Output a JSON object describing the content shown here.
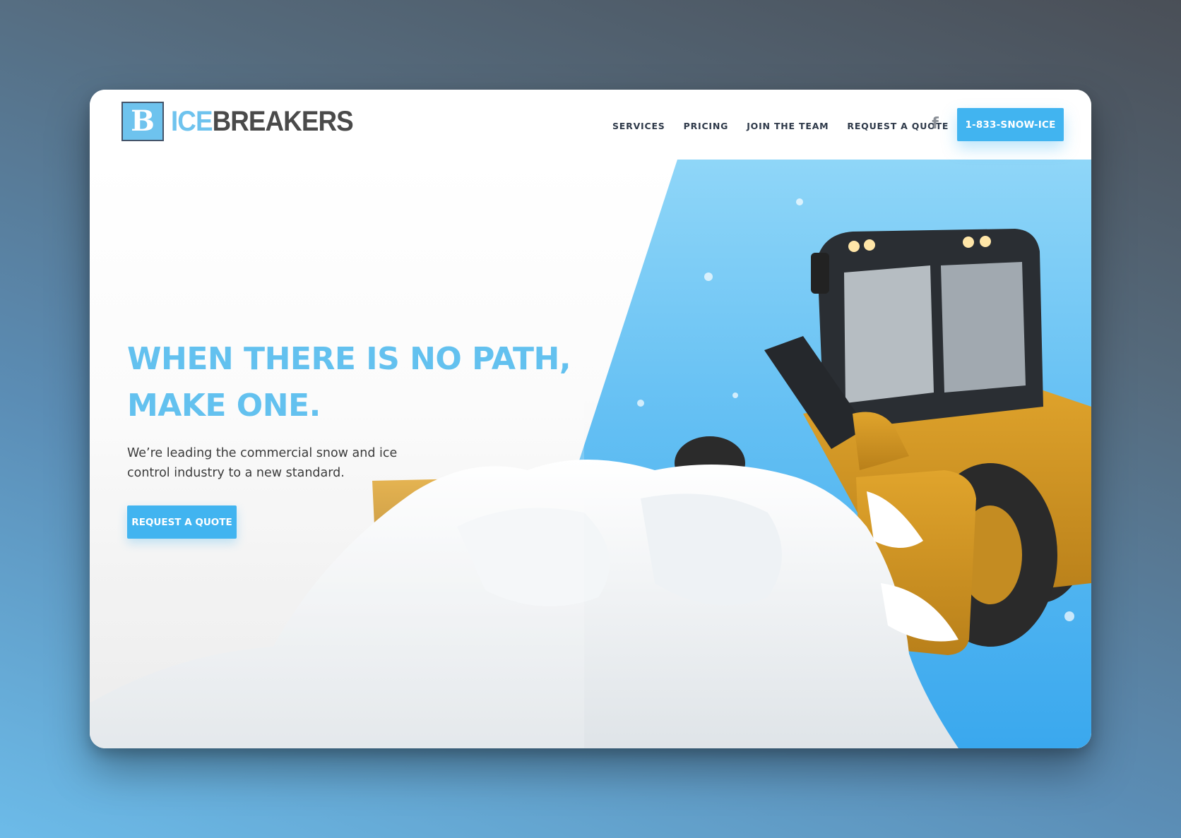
{
  "brand": {
    "logo_mark": "B",
    "name_part1": "ICE",
    "name_part2": "BREAKERS",
    "colors": {
      "accent": "#41b4f0",
      "headline": "#63c1ef",
      "dark": "#4a4a4a"
    }
  },
  "nav": {
    "items": [
      {
        "label": "SERVICES"
      },
      {
        "label": "PRICING"
      },
      {
        "label": "JOIN THE TEAM"
      },
      {
        "label": "REQUEST A QUOTE"
      }
    ],
    "social_icon": "facebook-icon",
    "social_glyph": "f",
    "phone_label": "1-833-SNOW-ICE"
  },
  "hero": {
    "headline_line1": "WHEN THERE IS NO PATH,",
    "headline_line2": "MAKE ONE.",
    "subtext": "We’re leading the commercial snow and ice control industry to a new standard.",
    "cta_label": "REQUEST A QUOTE"
  }
}
